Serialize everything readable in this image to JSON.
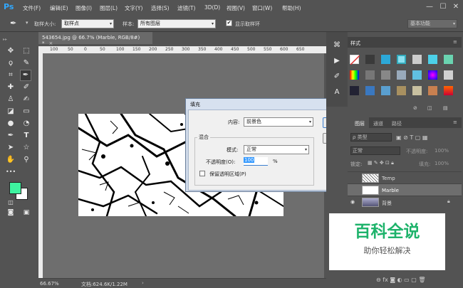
{
  "app": {
    "logo": "Ps"
  },
  "menu": [
    "文件(F)",
    "编辑(E)",
    "图像(I)",
    "图层(L)",
    "文字(Y)",
    "选择(S)",
    "滤镜(T)",
    "3D(D)",
    "视图(V)",
    "窗口(W)",
    "帮助(H)"
  ],
  "window_controls": [
    "—",
    "☐",
    "✕"
  ],
  "options": {
    "sample_size_label": "取样大小:",
    "sample_size_value": "取样点",
    "sample_label": "样本:",
    "sample_value": "所有图层",
    "show_ring_label": "显示取样环",
    "workspace": "基本功能"
  },
  "document": {
    "tab_label": "543654.jpg @ 66.7% (Marble, RGB/8#) *",
    "ruler_ticks": [
      "100",
      "50",
      "0",
      "50",
      "100",
      "150",
      "200",
      "250",
      "300",
      "350",
      "400",
      "450",
      "500",
      "550",
      "600",
      "650"
    ],
    "zoom": "66.67%",
    "doc_info": "文档:624.6K/1.22M"
  },
  "fill_dialog": {
    "title": "填充",
    "content_label": "内容:",
    "content_value": "前景色",
    "ok_label": "确定",
    "reset_label": "复位",
    "blend_group": "混合",
    "mode_label": "模式:",
    "mode_value": "正常",
    "opacity_label": "不透明度(O):",
    "opacity_value": "100",
    "opacity_unit": "%",
    "preserve_label": "保留透明区域(P)"
  },
  "styles_panel": {
    "tab": "样式"
  },
  "layers_panel": {
    "tabs": [
      "图层",
      "通道",
      "路径"
    ],
    "kind_label": "ρ 类型",
    "blend_value": "正常",
    "opacity_label": "不透明度:",
    "opacity_value": "100%",
    "lock_label": "锁定:",
    "fill_label": "填充:",
    "fill_value": "100%",
    "layers": [
      {
        "name": "Temp"
      },
      {
        "name": "Marble"
      },
      {
        "name": "背景"
      }
    ]
  },
  "watermark": {
    "title": "百科全说",
    "subtitle": "助你轻松解决"
  },
  "colors": {
    "foreground": "#3ef3a0",
    "background": "#ffffff",
    "accent": "#31a8ff"
  }
}
